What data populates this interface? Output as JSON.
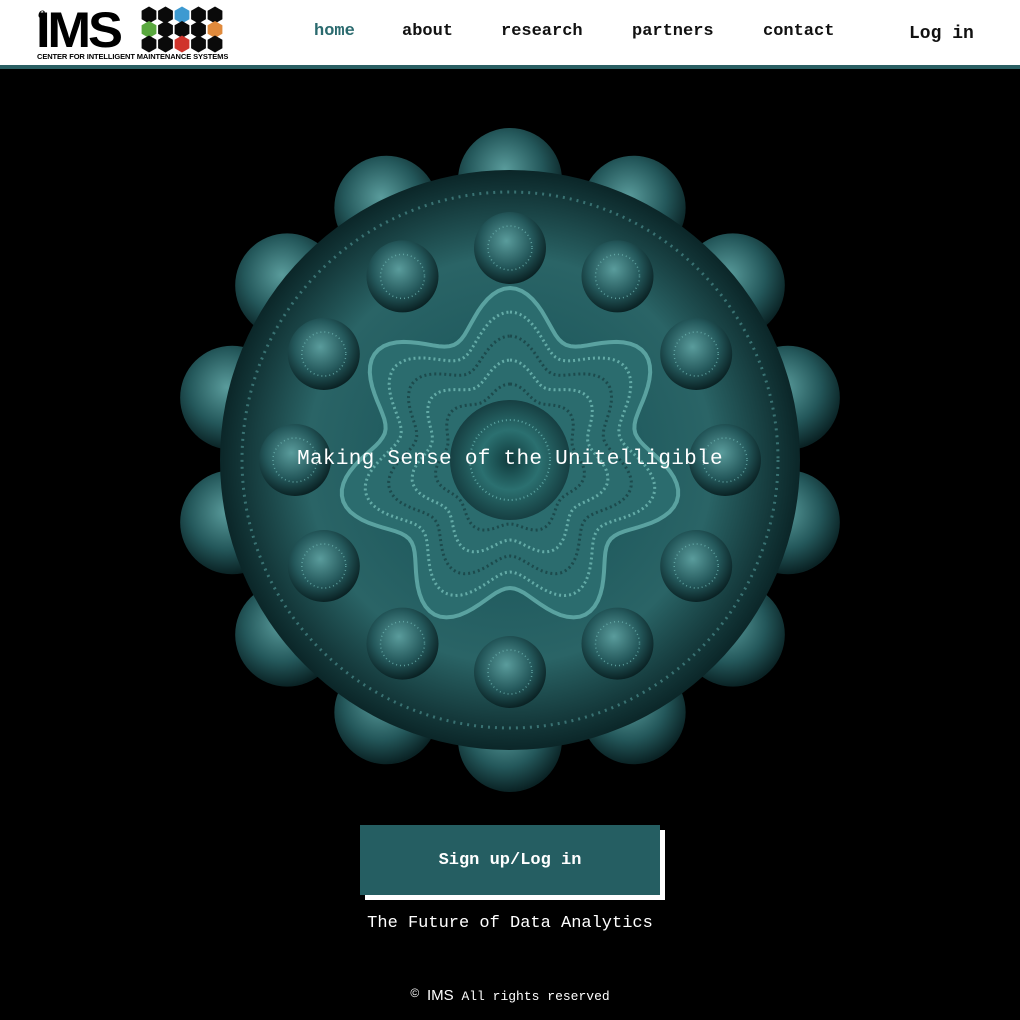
{
  "header": {
    "logo": {
      "prefix": "e",
      "name": "IMS",
      "subtitle": "CENTER FOR INTELLIGENT MAINTENANCE SYSTEMS",
      "hex_colors": {
        "blue": "#3d9ad1",
        "orange": "#e08a3c",
        "green": "#5aa83f",
        "red": "#d0342c",
        "black": "#0a0a0a"
      }
    },
    "nav": [
      {
        "label": "home",
        "active": true
      },
      {
        "label": "about",
        "active": false
      },
      {
        "label": "research",
        "active": false
      },
      {
        "label": "partners",
        "active": false
      },
      {
        "label": "contact",
        "active": false
      }
    ],
    "login_label": "Log in",
    "accent_color": "#2a5f63"
  },
  "hero": {
    "tagline": "Making Sense of the Unitelligible",
    "art_colors": {
      "base": "#1f5a5e",
      "light": "#4f9a9a",
      "dark": "#0b2628"
    }
  },
  "cta": {
    "label": "Sign up/Log in",
    "color": "#255e62"
  },
  "subtitle": "The Future of Data Analytics",
  "footer": {
    "copyright_symbol": "©",
    "brand": "IMS",
    "rights": "All rights reserved"
  }
}
